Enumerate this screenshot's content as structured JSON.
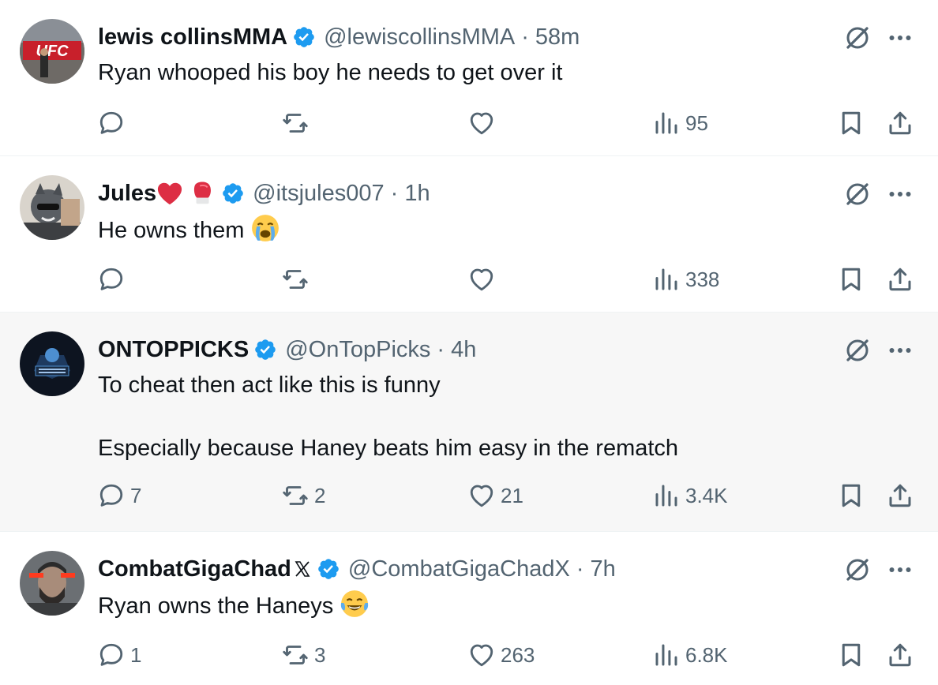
{
  "colors": {
    "verified": "#1d9bf0",
    "muted": "#536471",
    "text": "#0f1419",
    "highlight_bg": "#f7f7f7"
  },
  "tweets": [
    {
      "name": "lewis collinsMMA",
      "handle": "@lewiscollinsMMA",
      "time": "58m",
      "text": "Ryan whooped his boy he needs to get over it",
      "replies": "",
      "retweets": "",
      "likes": "",
      "views": "95"
    },
    {
      "name": "Jules",
      "handle": "@itsjules007",
      "time": "1h",
      "text": "He owns them",
      "replies": "",
      "retweets": "",
      "likes": "",
      "views": "338"
    },
    {
      "name": "ONTOPPICKS",
      "handle": "@OnTopPicks",
      "time": "4h",
      "text": "To cheat then act like this is funny\n\nEspecially because Haney beats him easy in the rematch",
      "replies": "7",
      "retweets": "2",
      "likes": "21",
      "views": "3.4K"
    },
    {
      "name": "CombatGigaChad",
      "handle": "@CombatGigaChadX",
      "time": "7h",
      "text": "Ryan owns the Haneys",
      "replies": "1",
      "retweets": "3",
      "likes": "263",
      "views": "6.8K"
    }
  ],
  "separator": "·",
  "icons": [
    "verified-badge-icon",
    "grok-icon",
    "more-icon",
    "reply-icon",
    "retweet-icon",
    "like-icon",
    "views-icon",
    "bookmark-icon",
    "share-icon",
    "loudly-crying-face-emoji",
    "tears-of-joy-emoji",
    "red-heart-emoji",
    "boxing-glove-emoji",
    "x-logo-icon"
  ]
}
